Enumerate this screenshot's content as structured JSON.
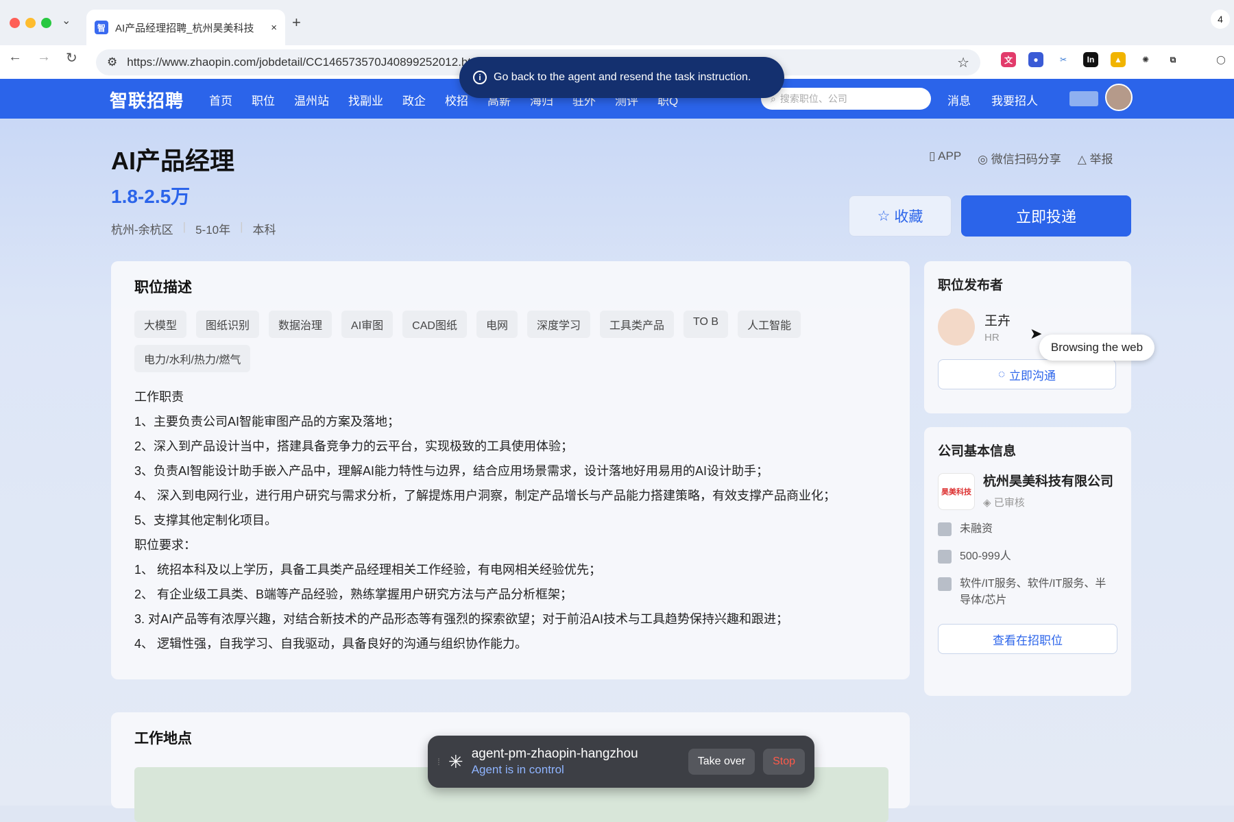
{
  "browser": {
    "tab_title": "AI产品经理招聘_杭州昊美科技",
    "tab_close": "×",
    "new_tab": "+",
    "url": "https://www.zhaopin.com/jobdetail/CC146573570J40899252012.htm",
    "corner_badge": "4"
  },
  "toast": {
    "text": "Go back to the agent and resend the task instruction."
  },
  "site": {
    "logo": "智联招聘",
    "menu": [
      "首页",
      "职位",
      "温州站",
      "找副业",
      "政企",
      "校招",
      "高薪",
      "海归",
      "驻外",
      "测评",
      "职Q"
    ],
    "search_placeholder": "搜索职位、公司",
    "messages": "消息",
    "recruit": "我要招人"
  },
  "job": {
    "title": "AI产品经理",
    "salary": "1.8-2.5万",
    "location": "杭州-余杭区",
    "experience": "5-10年",
    "education": "本科",
    "links": {
      "app": "APP",
      "share": "微信扫码分享",
      "report": "举报"
    },
    "fav_label": "收藏",
    "apply_label": "立即投递"
  },
  "description": {
    "heading": "职位描述",
    "tags": [
      "大模型",
      "图纸识别",
      "数据治理",
      "AI审图",
      "CAD图纸",
      "电网",
      "深度学习",
      "工具类产品",
      "TO B",
      "人工智能",
      "电力/水利/热力/燃气"
    ],
    "lines": [
      "工作职责",
      "1、主要负责公司AI智能审图产品的方案及落地；",
      "2、深入到产品设计当中，搭建具备竞争力的云平台，实现极致的工具使用体验；",
      "3、负责AI智能设计助手嵌入产品中，理解AI能力特性与边界，结合应用场景需求，设计落地好用易用的AI设计助手；",
      "4、 深入到电网行业，进行用户研究与需求分析，了解提炼用户洞察，制定产品增长与产品能力搭建策略，有效支撑产品商业化；",
      "5、支撑其他定制化项目。",
      "职位要求：",
      "1、 统招本科及以上学历，具备工具类产品经理相关工作经验，有电网相关经验优先；",
      "2、 有企业级工具类、B端等产品经验，熟练掌握用户研究方法与产品分析框架；",
      "3. 对AI产品等有浓厚兴趣，对结合新技术的产品形态等有强烈的探索欲望；对于前沿AI技术与工具趋势保持兴趣和跟进；",
      "4、 逻辑性强，自我学习、自我驱动，具备良好的沟通与组织协作能力。"
    ]
  },
  "publisher": {
    "heading": "职位发布者",
    "name": "王卉",
    "role": "HR",
    "chat_label": "立即沟通",
    "tooltip": "Browsing the web"
  },
  "company": {
    "heading": "公司基本信息",
    "logo_text": "昊美科技",
    "name": "杭州昊美科技有限公司",
    "verified": "已审核",
    "funding": "未融资",
    "size": "500-999人",
    "industry": "软件/IT服务、软件/IT服务、半导体/芯片",
    "view_jobs": "查看在招职位"
  },
  "location_section": {
    "heading": "工作地点"
  },
  "agent": {
    "name": "agent-pm-zhaopin-hangzhou",
    "status": "Agent is in control",
    "takeover": "Take over",
    "stop": "Stop"
  }
}
